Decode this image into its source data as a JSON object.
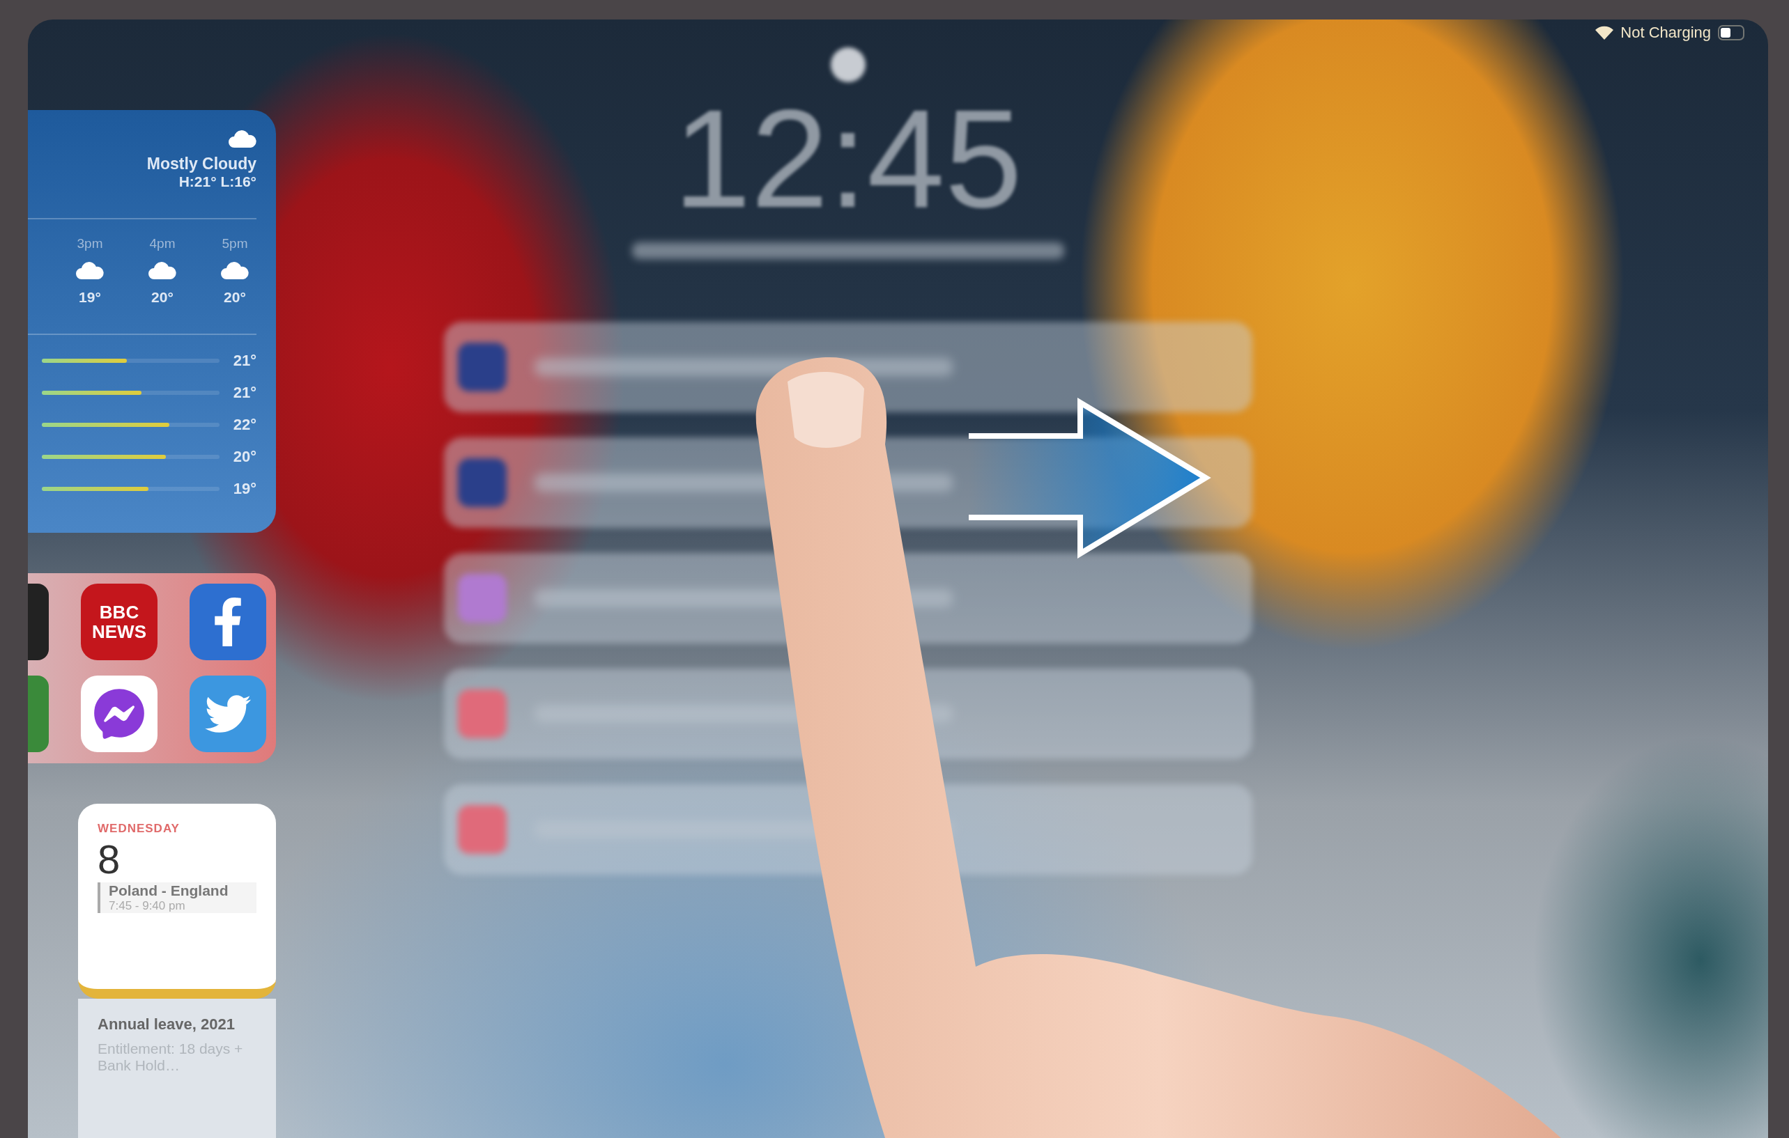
{
  "status_bar": {
    "battery_text": "Not Charging"
  },
  "weather": {
    "condition": "Mostly Cloudy",
    "high_low": "H:21° L:16°",
    "hourly": [
      {
        "time": "3pm",
        "temp": "19°"
      },
      {
        "time": "4pm",
        "temp": "20°"
      },
      {
        "time": "5pm",
        "temp": "20°"
      }
    ],
    "daily": [
      {
        "temp": "21°",
        "level": 0.48
      },
      {
        "temp": "21°",
        "level": 0.56
      },
      {
        "temp": "22°",
        "level": 0.72
      },
      {
        "temp": "20°",
        "level": 0.7
      },
      {
        "temp": "19°",
        "level": 0.6
      }
    ]
  },
  "apps": [
    {
      "kind": "cut"
    },
    {
      "kind": "news",
      "label": "BBC NEWS"
    },
    {
      "kind": "facebook"
    },
    {
      "kind": "cut"
    },
    {
      "kind": "messenger"
    },
    {
      "kind": "twitter"
    }
  ],
  "calendar": {
    "weekday": "WEDNESDAY",
    "day": "8",
    "event": "Poland - England",
    "event_time": "7:45 - 9:40 pm"
  },
  "note": {
    "title": "Annual leave, 2021",
    "body": "Entitlement: 18 days + Bank Hold…"
  },
  "lock_screen": {
    "time": "12:45"
  }
}
